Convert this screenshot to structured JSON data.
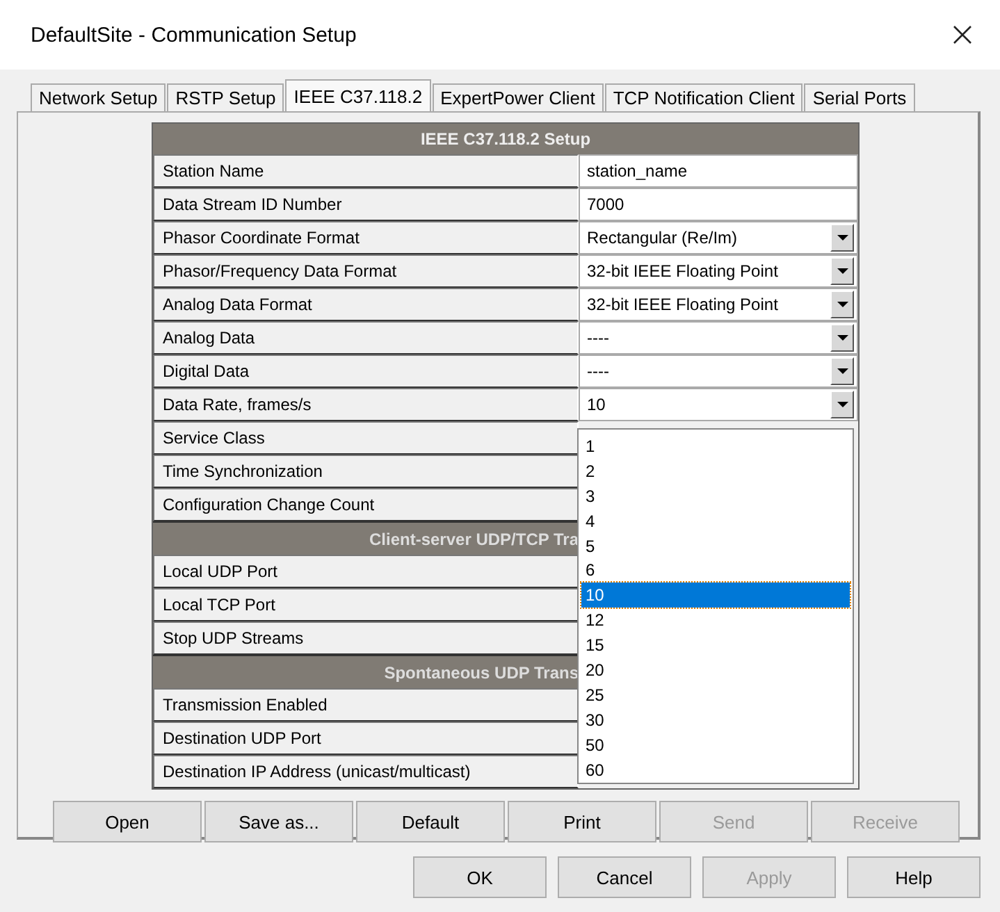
{
  "window": {
    "title": "DefaultSite - Communication Setup"
  },
  "tabs": [
    {
      "label": "Network Setup",
      "selected": false
    },
    {
      "label": "RSTP Setup",
      "selected": false
    },
    {
      "label": "IEEE C37.118.2",
      "selected": true
    },
    {
      "label": "ExpertPower Client",
      "selected": false
    },
    {
      "label": "TCP Notification Client",
      "selected": false
    },
    {
      "label": "Serial Ports",
      "selected": false
    }
  ],
  "table": {
    "title": "IEEE C37.118.2 Setup",
    "rows": [
      {
        "kind": "field",
        "label": "Station Name",
        "value": "station_name"
      },
      {
        "kind": "field",
        "label": "Data Stream ID Number",
        "value": "7000"
      },
      {
        "kind": "select",
        "label": "Phasor Coordinate Format",
        "value": "Rectangular (Re/Im)"
      },
      {
        "kind": "select",
        "label": "Phasor/Frequency Data Format",
        "value": "32-bit IEEE Floating Point"
      },
      {
        "kind": "select",
        "label": "Analog Data Format",
        "value": "32-bit IEEE Floating Point"
      },
      {
        "kind": "select",
        "label": "Analog Data",
        "value": "----"
      },
      {
        "kind": "select",
        "label": "Digital Data",
        "value": "----"
      },
      {
        "kind": "select",
        "label": "Data Rate, frames/s",
        "value": "10"
      },
      {
        "kind": "label",
        "label": "Service Class"
      },
      {
        "kind": "label",
        "label": "Time Synchronization"
      },
      {
        "kind": "label",
        "label": "Configuration Change Count"
      },
      {
        "kind": "section",
        "label": "Client-server UDP/TCP Tra"
      },
      {
        "kind": "label",
        "label": "Local UDP Port"
      },
      {
        "kind": "label",
        "label": "Local TCP Port"
      },
      {
        "kind": "label",
        "label": "Stop UDP Streams"
      },
      {
        "kind": "section",
        "label": "Spontaneous UDP Trans"
      },
      {
        "kind": "label",
        "label": "Transmission Enabled"
      },
      {
        "kind": "label",
        "label": "Destination UDP Port"
      },
      {
        "kind": "label",
        "label": "Destination IP Address (unicast/multicast)"
      }
    ]
  },
  "dropdown_list": {
    "options": [
      {
        "label": "1",
        "selected": false
      },
      {
        "label": "2",
        "selected": false
      },
      {
        "label": "3",
        "selected": false
      },
      {
        "label": "4",
        "selected": false
      },
      {
        "label": "5",
        "selected": false
      },
      {
        "label": "6",
        "selected": false
      },
      {
        "label": "10",
        "selected": true
      },
      {
        "label": "12",
        "selected": false
      },
      {
        "label": "15",
        "selected": false
      },
      {
        "label": "20",
        "selected": false
      },
      {
        "label": "25",
        "selected": false
      },
      {
        "label": "30",
        "selected": false
      },
      {
        "label": "50",
        "selected": false
      },
      {
        "label": "60",
        "selected": false
      }
    ]
  },
  "action_buttons": [
    {
      "label": "Open",
      "disabled": false
    },
    {
      "label": "Save as...",
      "disabled": false
    },
    {
      "label": "Default",
      "disabled": false
    },
    {
      "label": "Print",
      "disabled": false
    },
    {
      "label": "Send",
      "disabled": true
    },
    {
      "label": "Receive",
      "disabled": true
    }
  ],
  "dialog_buttons": [
    {
      "label": "OK",
      "disabled": false
    },
    {
      "label": "Cancel",
      "disabled": false
    },
    {
      "label": "Apply",
      "disabled": true
    },
    {
      "label": "Help",
      "disabled": false
    }
  ]
}
